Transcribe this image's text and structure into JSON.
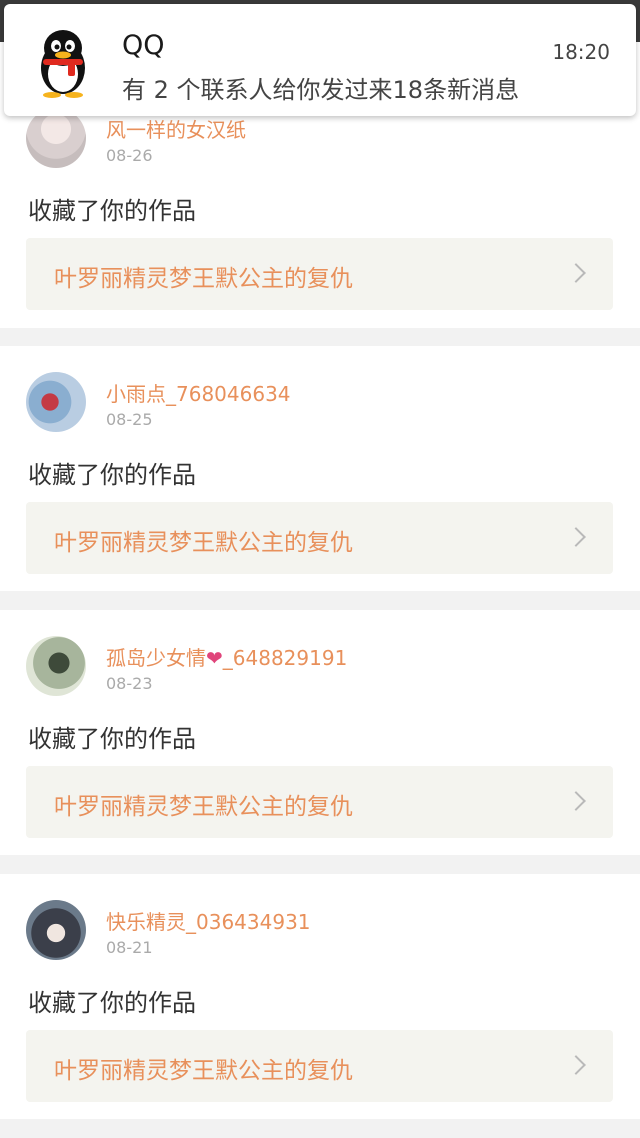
{
  "notification": {
    "app_name": "QQ",
    "message": "有 2 个联系人给你发过来18条新消息",
    "time": "18:20"
  },
  "feed": {
    "items": [
      {
        "username": "风一样的女汉纸",
        "date": "08-26",
        "action": "收藏了你的作品",
        "work_title": "叶罗丽精灵梦王默公主的复仇"
      },
      {
        "username": "小雨点_768046634",
        "date": "08-25",
        "action": "收藏了你的作品",
        "work_title": "叶罗丽精灵梦王默公主的复仇"
      },
      {
        "username_prefix": "孤岛少女情",
        "username_suffix": "_648829191",
        "date": "08-23",
        "action": "收藏了你的作品",
        "work_title": "叶罗丽精灵梦王默公主的复仇"
      },
      {
        "username": "快乐精灵_036434931",
        "date": "08-21",
        "action": "收藏了你的作品",
        "work_title": "叶罗丽精灵梦王默公主的复仇"
      }
    ]
  },
  "colors": {
    "accent": "#e8905b",
    "card_bg": "#ffffff",
    "work_bg": "#f4f4ef",
    "page_bg": "#f2f2f2"
  },
  "icons": [
    "qq-penguin-icon",
    "back-arrow-icon",
    "search-icon",
    "chevron-right-icon",
    "heart-icon"
  ]
}
